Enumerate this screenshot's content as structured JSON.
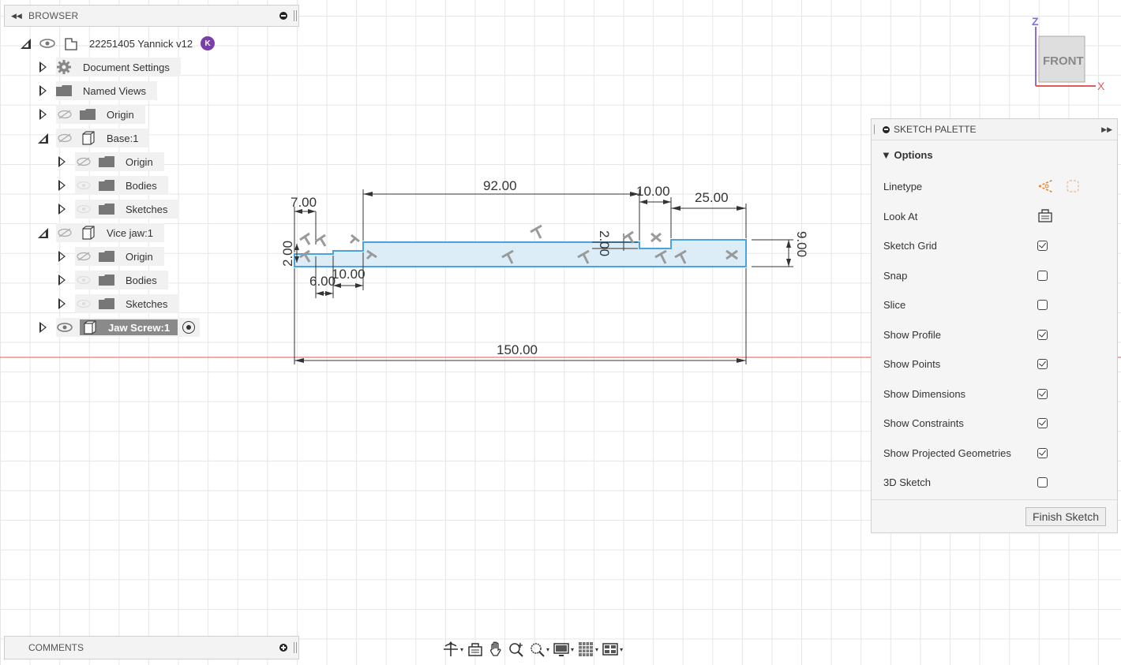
{
  "browser": {
    "title": "BROWSER",
    "collapse_icon": "double-left-arrow",
    "root": {
      "label": "22251405 Yannick v12",
      "avatar_initial": "K"
    },
    "items": [
      {
        "label": "Document Settings"
      },
      {
        "label": "Named Views"
      },
      {
        "label": "Origin"
      },
      {
        "label": "Base:1"
      },
      {
        "label": "Origin"
      },
      {
        "label": "Bodies"
      },
      {
        "label": "Sketches"
      },
      {
        "label": "Vice jaw:1"
      },
      {
        "label": "Origin"
      },
      {
        "label": "Bodies"
      },
      {
        "label": "Sketches"
      },
      {
        "label": "Jaw Screw:1"
      }
    ]
  },
  "comments": {
    "title": "COMMENTS"
  },
  "viewcube": {
    "face": "FRONT",
    "axis_z": "Z",
    "axis_x": "X"
  },
  "palette": {
    "title": "SKETCH PALETTE",
    "section": "Options",
    "rows": [
      {
        "label": "Linetype",
        "type": "icons"
      },
      {
        "label": "Look At",
        "type": "icon"
      },
      {
        "label": "Sketch Grid",
        "checked": true
      },
      {
        "label": "Snap",
        "checked": false
      },
      {
        "label": "Slice",
        "checked": false
      },
      {
        "label": "Show Profile",
        "checked": true
      },
      {
        "label": "Show Points",
        "checked": true
      },
      {
        "label": "Show Dimensions",
        "checked": true
      },
      {
        "label": "Show Constraints",
        "checked": true
      },
      {
        "label": "Show Projected Geometries",
        "checked": true
      },
      {
        "label": "3D Sketch",
        "checked": false
      }
    ],
    "finish_label": "Finish Sketch"
  },
  "sketch": {
    "dims": {
      "d92": "92.00",
      "d10a": "10.00",
      "d25": "25.00",
      "d7": "7.00",
      "d2": "2.00",
      "d6": "6.00",
      "d10b": "10.00",
      "d150": "150.00",
      "d9": "9.00",
      "d2b": "2.00"
    }
  },
  "toolbar": {
    "icons": [
      "orbit-icon",
      "look-at-icon",
      "pan-icon",
      "zoom-icon",
      "fit-icon",
      "display-settings-icon",
      "grid-icon",
      "viewports-icon"
    ]
  }
}
